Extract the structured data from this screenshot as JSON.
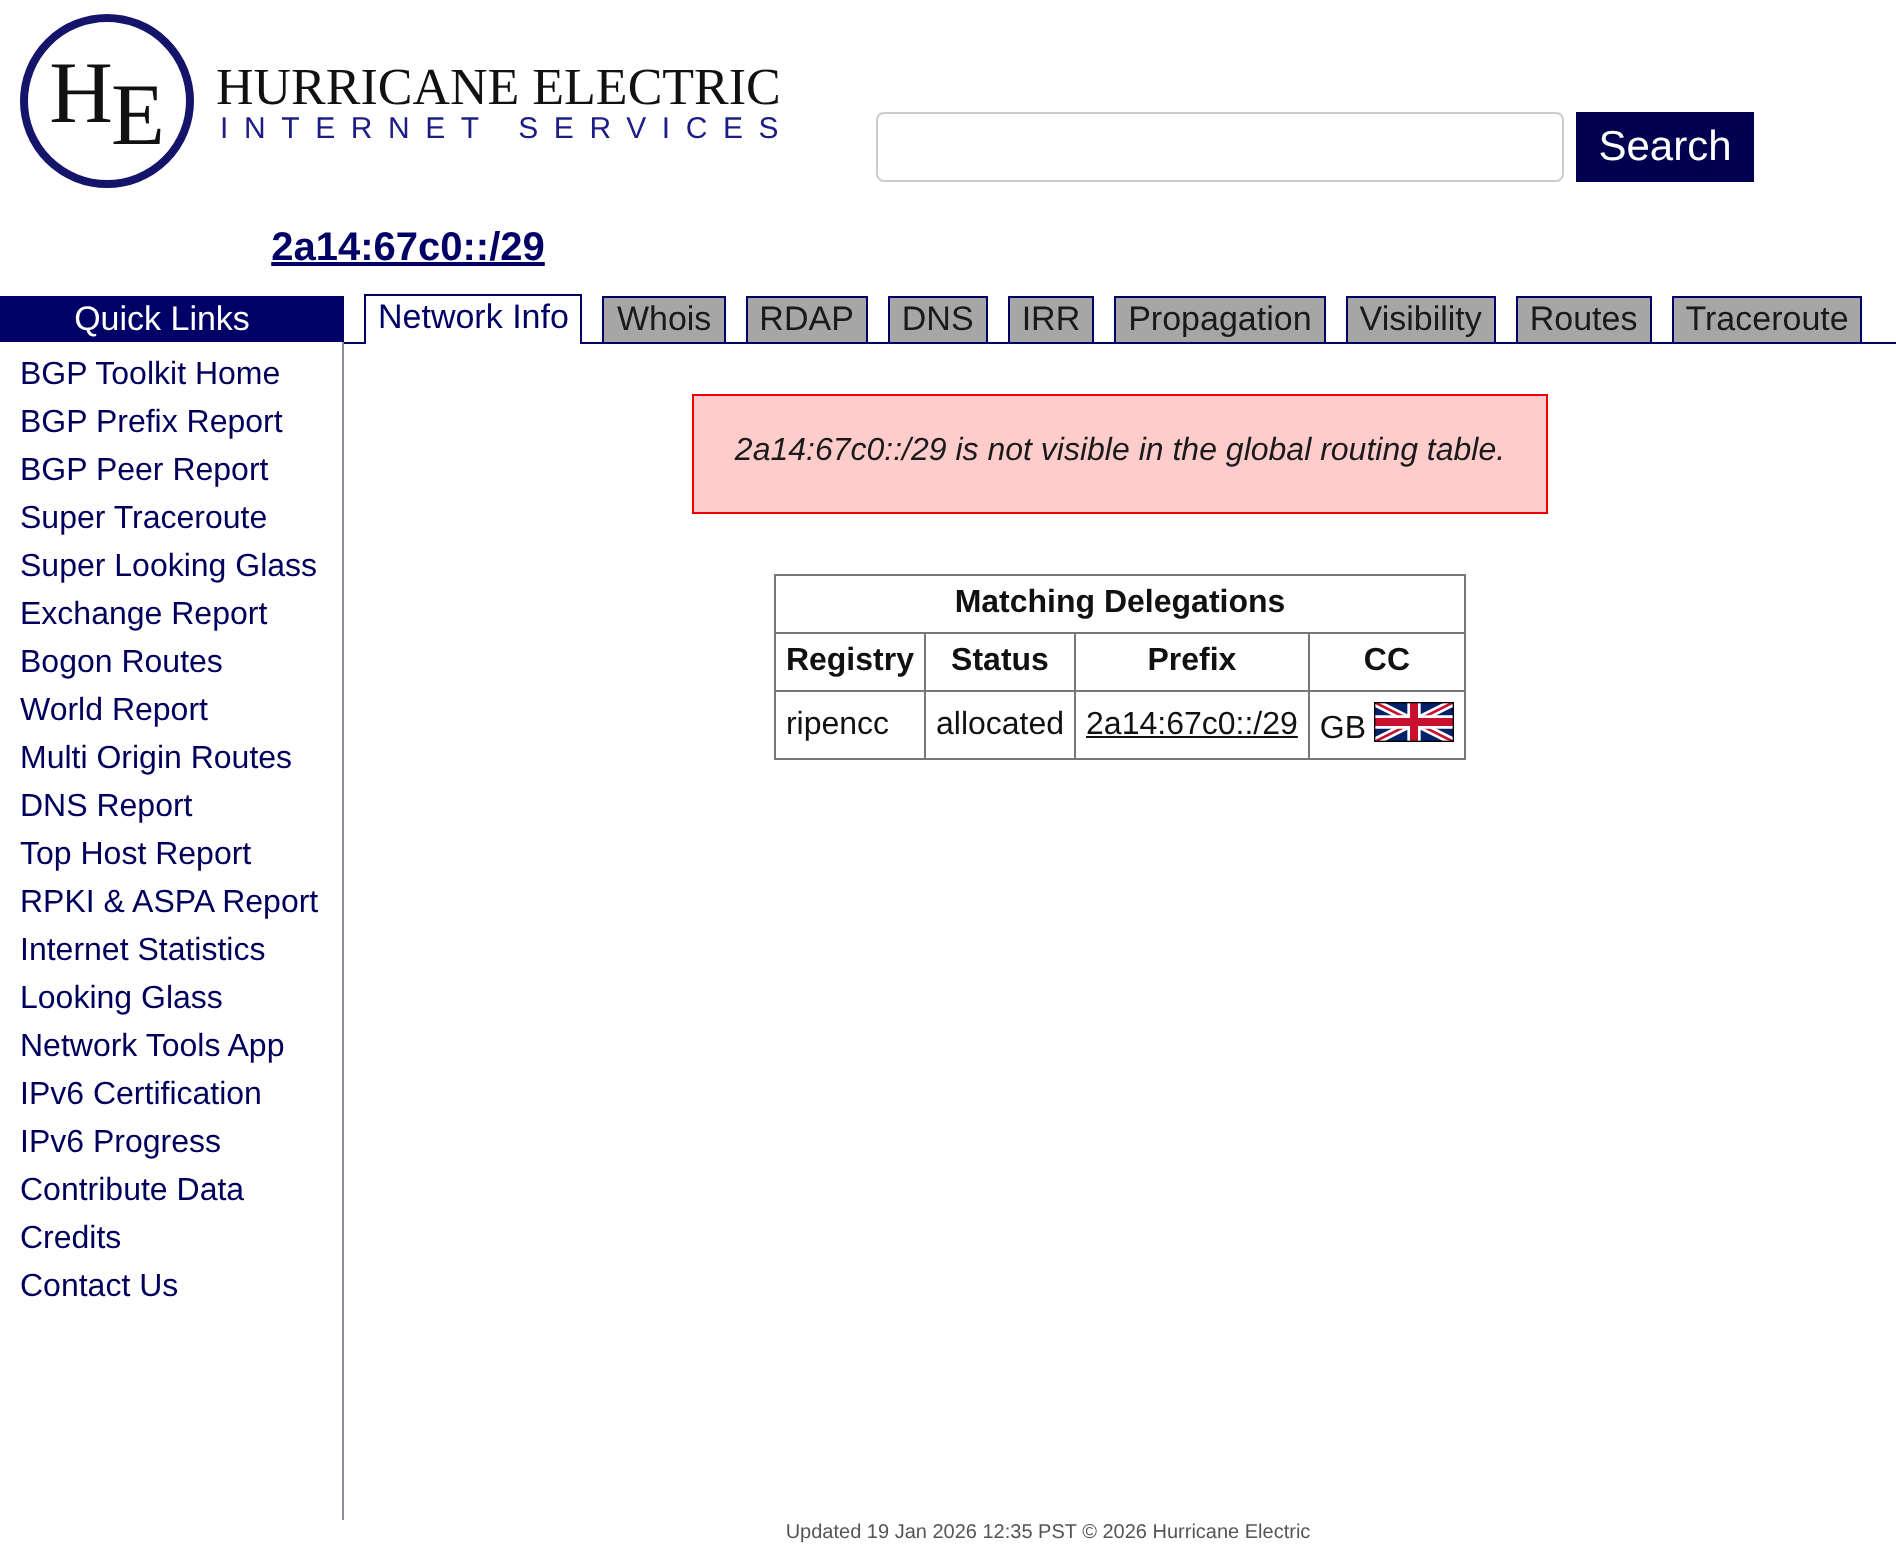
{
  "logo": {
    "monogram": "H$_{E}$",
    "name": "HURRICANE ELECTRIC",
    "tagline": "INTERNET SERVICES"
  },
  "search": {
    "button": "Search"
  },
  "title": "2a14:67c0::/29",
  "sidebar": {
    "title": "Quick Links",
    "items": [
      "BGP Toolkit Home",
      "BGP Prefix Report",
      "BGP Peer Report",
      "Super Traceroute",
      "Super Looking Glass",
      "Exchange Report",
      "Bogon Routes",
      "World Report",
      "Multi Origin Routes",
      "DNS Report",
      "Top Host Report",
      "RPKI & ASPA Report",
      "Internet Statistics",
      "Looking Glass",
      "Network Tools App",
      "IPv6 Certification",
      "IPv6 Progress",
      "Contribute Data",
      "Credits",
      "Contact Us"
    ]
  },
  "tabs": [
    {
      "label": "Network Info",
      "selected": true
    },
    {
      "label": "Whois",
      "selected": false
    },
    {
      "label": "RDAP",
      "selected": false
    },
    {
      "label": "DNS",
      "selected": false
    },
    {
      "label": "IRR",
      "selected": false
    },
    {
      "label": "Propagation",
      "selected": false
    },
    {
      "label": "Visibility",
      "selected": false
    },
    {
      "label": "Routes",
      "selected": false
    },
    {
      "label": "Traceroute",
      "selected": false
    }
  ],
  "alert": "2a14:67c0::/29 is not visible in the global routing table.",
  "table": {
    "title": "Matching Delegations",
    "columns": [
      "Registry",
      "Status",
      "Prefix",
      "CC"
    ],
    "rows": [
      {
        "registry": "ripencc",
        "status": "allocated",
        "prefix": "2a14:67c0::/29",
        "cc": "GB"
      }
    ]
  },
  "footer": "Updated 19 Jan 2026 12:35 PST © 2026 Hurricane Electric"
}
